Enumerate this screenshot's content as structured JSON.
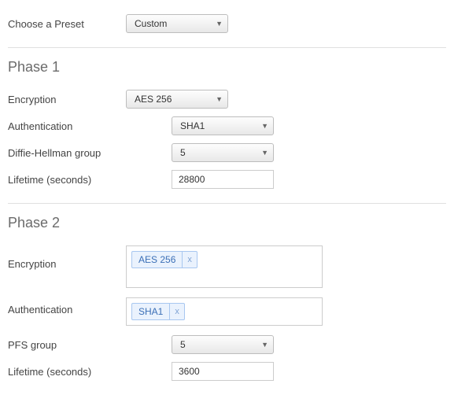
{
  "preset": {
    "label": "Choose a Preset",
    "value": "Custom"
  },
  "phase1": {
    "title": "Phase 1",
    "encryption": {
      "label": "Encryption",
      "value": "AES 256"
    },
    "authentication": {
      "label": "Authentication",
      "value": "SHA1"
    },
    "dh": {
      "label": "Diffie-Hellman group",
      "value": "5"
    },
    "lifetime": {
      "label": "Lifetime (seconds)",
      "value": "28800"
    }
  },
  "phase2": {
    "title": "Phase 2",
    "encryption": {
      "label": "Encryption",
      "tag": "AES 256"
    },
    "authentication": {
      "label": "Authentication",
      "tag": "SHA1"
    },
    "pfs": {
      "label": "PFS group",
      "value": "5"
    },
    "lifetime": {
      "label": "Lifetime (seconds)",
      "value": "3600"
    }
  },
  "glyphs": {
    "x": "x"
  }
}
